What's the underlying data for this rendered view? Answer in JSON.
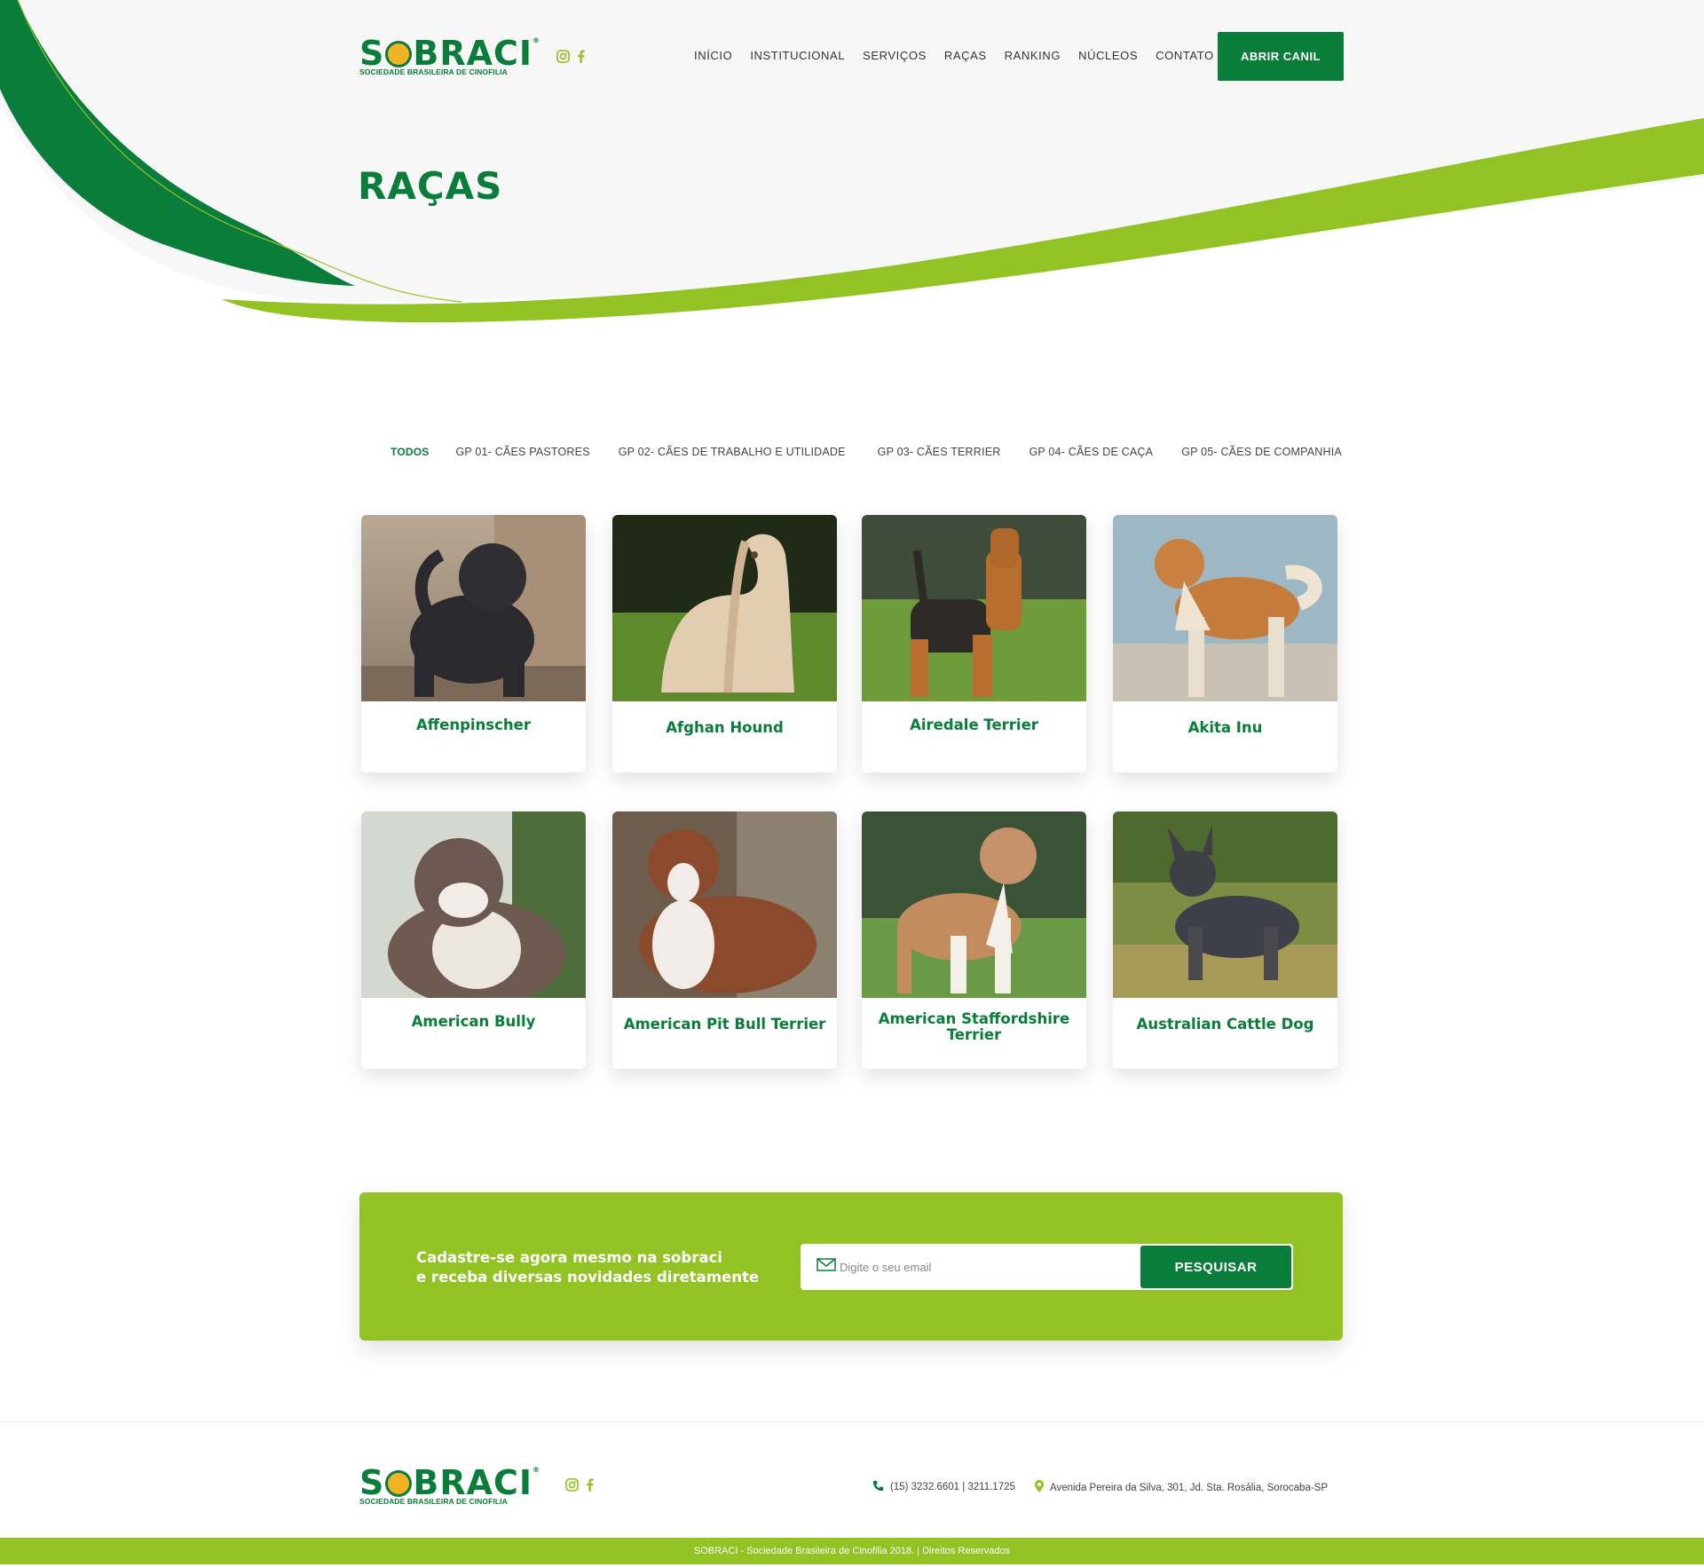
{
  "header": {
    "logo_text_left": "S",
    "logo_text_right": "BRACI",
    "logo_registered": "®",
    "logo_subtitle": "SOCIEDADE BRASILEIRA DE CINOFILIA",
    "nav": [
      "INÍCIO",
      "INSTITUCIONAL",
      "SERVIÇOS",
      "RAÇAS",
      "RANKING",
      "NÚCLEOS",
      "CONTATO"
    ],
    "cta": "ABRIR CANIL",
    "social_icons": [
      "instagram-icon",
      "facebook-icon"
    ]
  },
  "page": {
    "title": "RAÇAS"
  },
  "tabs": [
    "TODOS",
    "GP 01- CÃES PASTORES",
    "GP 02- CÃES DE TRABALHO E UTILIDADE",
    "GP 03- CÃES TERRIER",
    "GP 04- CÃES DE CAÇA",
    "GP 05- CÃES DE COMPANHIA"
  ],
  "active_tab": "TODOS",
  "breeds": [
    "Affenpinscher",
    "Afghan Hound",
    "Airedale Terrier",
    "Akita Inu",
    "American Bully",
    "American Pit Bull Terrier",
    "American Staffordshire Terrier",
    "Australian Cattle Dog"
  ],
  "newsletter": {
    "line1": "Cadastre-se agora mesmo na sobraci",
    "line2": "e receba diversas novidades diretamente",
    "placeholder": "Digite o seu email",
    "button": "PESQUISAR"
  },
  "footer": {
    "phone": "(15) 3232.6601 | 3211.1725",
    "address": "Avenida Pereira da Silva, 301, Jd. Sta. Rosália, Sorocaba-SP",
    "copyright": "SOBRACI - Sociedade Brasileira de Cinofilia 2018. | Direitos Reservados"
  },
  "colors": {
    "primary_green": "#0a7d3b",
    "lime_green": "#93c225",
    "hero_bg": "#f7f7f7"
  }
}
